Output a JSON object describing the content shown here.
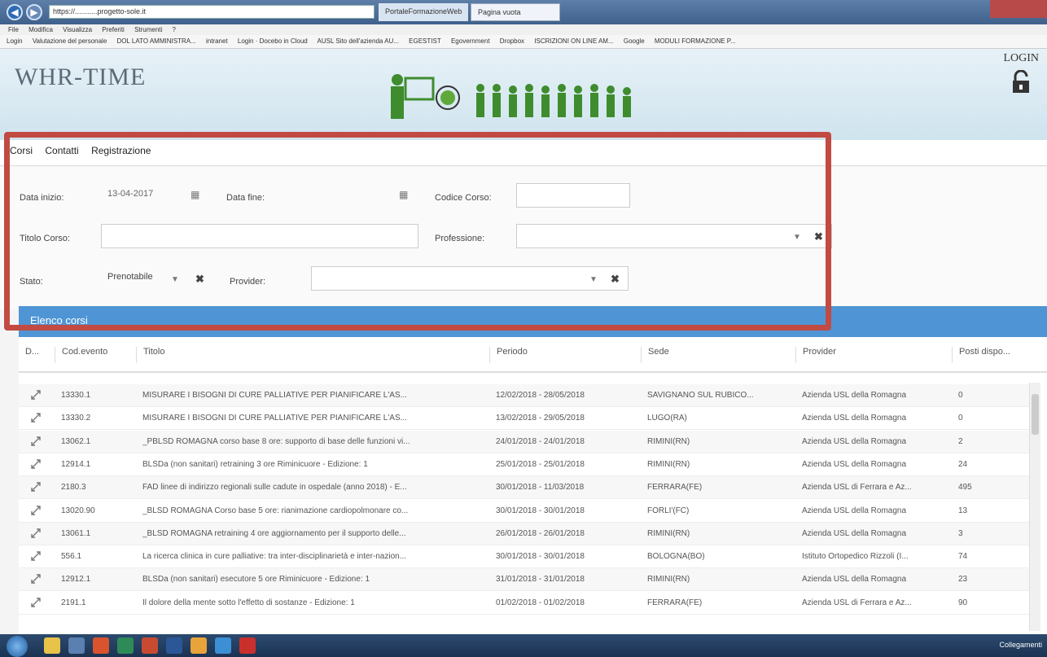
{
  "browser": {
    "address": "https://...........progetto-sole.it",
    "tab1": "PortaleFormazioneWeb",
    "tab2": "Pagina vuota",
    "menu": [
      "File",
      "Modifica",
      "Visualizza",
      "Preferiti",
      "Strumenti",
      "?"
    ],
    "favorites": [
      "Login",
      "Valutazione del personale",
      "DOL LATO AMMINISTRA...",
      "intranet",
      "Login · Docebo in Cloud",
      "AUSL Sito dell'azienda AU...",
      "EGESTIST",
      "Egovernment",
      "Dropbox",
      "ISCRIZIONI ON LINE AM...",
      "Google",
      "MODULI FORMAZIONE P..."
    ]
  },
  "header": {
    "logo": "WHR-TIME",
    "login": "LOGIN"
  },
  "nav": {
    "corsi": "Corsi",
    "contatti": "Contatti",
    "registrazione": "Registrazione"
  },
  "filters": {
    "data_inizio_label": "Data inizio:",
    "data_inizio_value": "13-04-2017",
    "data_fine_label": "Data fine:",
    "data_fine_value": "",
    "codice_corso_label": "Codice Corso:",
    "titolo_corso_label": "Titolo Corso:",
    "professione_label": "Professione:",
    "stato_label": "Stato:",
    "stato_value": "Prenotabile",
    "provider_label": "Provider:"
  },
  "panel": {
    "title": "Elenco corsi"
  },
  "table": {
    "columns": [
      "D...",
      "Cod.evento",
      "Titolo",
      "Periodo",
      "Sede",
      "Provider",
      "Posti dispo..."
    ],
    "rows": [
      [
        "13330.1",
        "MISURARE I BISOGNI DI CURE PALLIATIVE PER PIANIFICARE L'AS...",
        "12/02/2018 - 28/05/2018",
        "SAVIGNANO SUL RUBICO...",
        "Azienda USL della Romagna",
        "0"
      ],
      [
        "13330.2",
        "MISURARE I BISOGNI DI CURE PALLIATIVE PER PIANIFICARE L'AS...",
        "13/02/2018 - 29/05/2018",
        "LUGO(RA)",
        "Azienda USL della Romagna",
        "0"
      ],
      [
        "13062.1",
        "_PBLSD ROMAGNA corso base 8 ore: supporto di base delle funzioni vi...",
        "24/01/2018 - 24/01/2018",
        "RIMINI(RN)",
        "Azienda USL della Romagna",
        "2"
      ],
      [
        "12914.1",
        "BLSDa (non sanitari) retraining 3 ore Riminicuore - Edizione: 1",
        "25/01/2018 - 25/01/2018",
        "RIMINI(RN)",
        "Azienda USL della Romagna",
        "24"
      ],
      [
        "2180.3",
        "FAD linee di indirizzo regionali sulle cadute in ospedale (anno 2018) - E...",
        "30/01/2018 - 11/03/2018",
        "FERRARA(FE)",
        "Azienda USL di Ferrara e Az...",
        "495"
      ],
      [
        "13020.90",
        "_BLSD ROMAGNA Corso base 5 ore: rianimazione cardiopolmonare co...",
        "30/01/2018 - 30/01/2018",
        "FORLI'(FC)",
        "Azienda USL della Romagna",
        "13"
      ],
      [
        "13061.1",
        "_BLSD ROMAGNA retraining 4 ore aggiornamento per il supporto delle...",
        "26/01/2018 - 26/01/2018",
        "RIMINI(RN)",
        "Azienda USL della Romagna",
        "3"
      ],
      [
        "556.1",
        "La ricerca clinica in cure palliative: tra inter-disciplinarietà e inter-nazion...",
        "30/01/2018 - 30/01/2018",
        "BOLOGNA(BO)",
        "Istituto Ortopedico Rizzoli (I...",
        "74"
      ],
      [
        "12912.1",
        "BLSDa (non sanitari) esecutore 5 ore Riminicuore - Edizione: 1",
        "31/01/2018 - 31/01/2018",
        "RIMINI(RN)",
        "Azienda USL della Romagna",
        "23"
      ],
      [
        "2191.1",
        "Il dolore della mente sotto l'effetto di sostanze - Edizione: 1",
        "01/02/2018 - 01/02/2018",
        "FERRARA(FE)",
        "Azienda USL di Ferrara e Az...",
        "90"
      ]
    ]
  },
  "taskbar": {
    "tray": "Collegamenti"
  },
  "colors": {
    "accent": "#4f95d5",
    "highlight": "#c14a42"
  }
}
